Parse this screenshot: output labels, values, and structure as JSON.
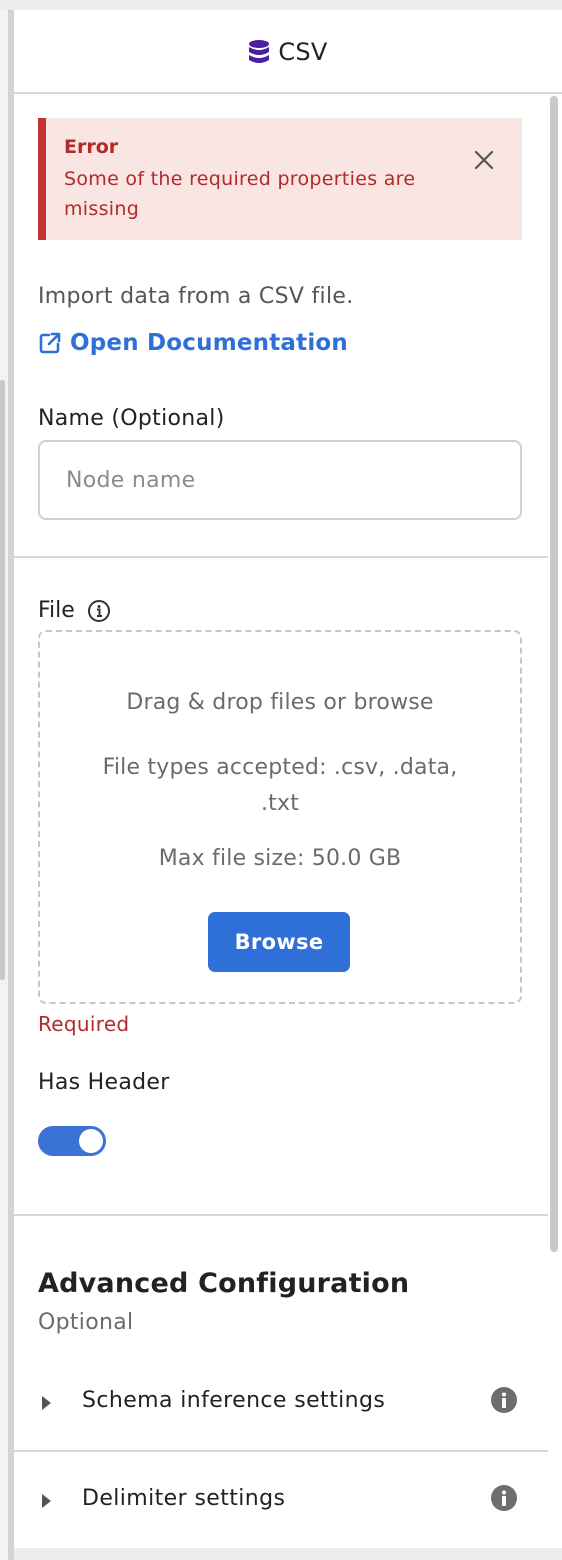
{
  "header": {
    "title": "CSV",
    "icon": "database-icon"
  },
  "alert": {
    "title": "Error",
    "message": "Some of the required properties are missing",
    "close_icon": "close-icon"
  },
  "description": "Import data from a CSV file.",
  "doc_link": {
    "label": "Open Documentation",
    "icon": "external-link-icon"
  },
  "name_field": {
    "label": "Name (Optional)",
    "placeholder": "Node name",
    "value": ""
  },
  "file_field": {
    "label": "File",
    "drop_text": "Drag & drop files or browse",
    "types_text": "File types accepted: .csv, .data, .txt",
    "max_size_text": "Max file size: 50.0 GB",
    "browse_label": "Browse",
    "error_text": "Required"
  },
  "has_header": {
    "label": "Has Header",
    "enabled": true
  },
  "advanced": {
    "title": "Advanced Configuration",
    "subtitle": "Optional",
    "sections": [
      {
        "label": "Schema inference settings",
        "icon": "info-icon"
      },
      {
        "label": "Delimiter settings",
        "icon": "info-icon"
      }
    ]
  },
  "colors": {
    "accent": "#2f6fd8",
    "error": "#b22a2a",
    "error_bg": "#f9e5e2",
    "header_icon": "#4b1fa3"
  }
}
